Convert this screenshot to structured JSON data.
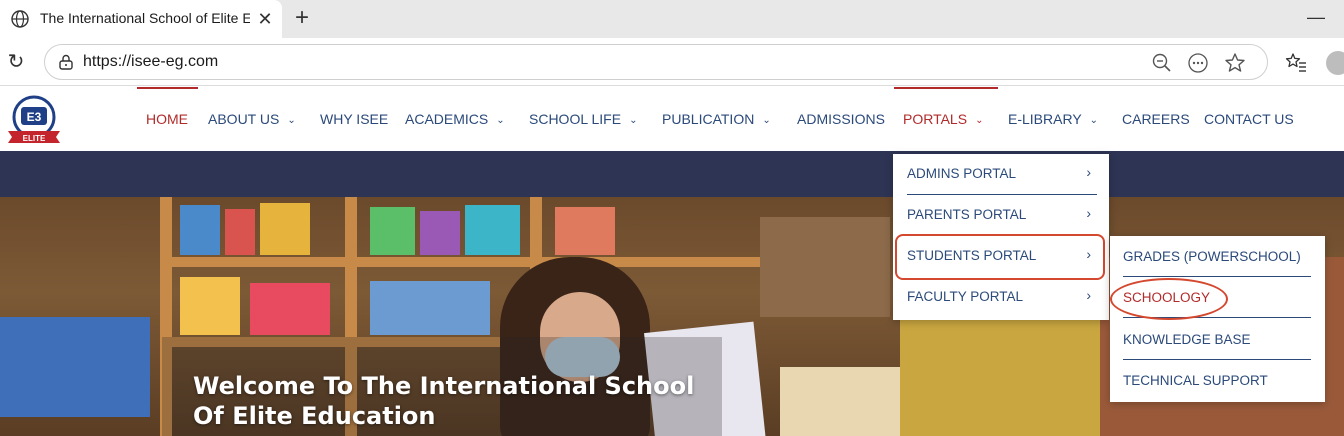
{
  "browser": {
    "tab_title": "The International School of Elite E",
    "url": "https://isee-eg.com",
    "icons": [
      "globe-icon",
      "close-icon",
      "plus-icon",
      "minimize-icon",
      "refresh-icon",
      "lock-icon",
      "zoom-out-icon",
      "more-icon",
      "star-icon",
      "favorites-icon",
      "avatar"
    ]
  },
  "site": {
    "logo_text": "ELITE",
    "nav": [
      {
        "label": "HOME",
        "has_menu": false
      },
      {
        "label": "ABOUT US",
        "has_menu": true
      },
      {
        "label": "WHY ISEE",
        "has_menu": false
      },
      {
        "label": "ACADEMICS",
        "has_menu": true
      },
      {
        "label": "SCHOOL LIFE",
        "has_menu": true
      },
      {
        "label": "PUBLICATION",
        "has_menu": true
      },
      {
        "label": "ADMISSIONS",
        "has_menu": false
      },
      {
        "label": "PORTALS",
        "has_menu": true
      },
      {
        "label": "E-LIBRARY",
        "has_menu": true
      },
      {
        "label": "CAREERS",
        "has_menu": false
      },
      {
        "label": "CONTACT US",
        "has_menu": false
      }
    ],
    "portals_menu": [
      {
        "label": "ADMINS PORTAL"
      },
      {
        "label": "PARENTS PORTAL"
      },
      {
        "label": "STUDENTS PORTAL"
      },
      {
        "label": "FACULTY PORTAL"
      }
    ],
    "students_menu": [
      {
        "label": "GRADES (POWERSCHOOL)"
      },
      {
        "label": "SCHOOLOGY"
      },
      {
        "label": "KNOWLEDGE BASE"
      },
      {
        "label": "TECHNICAL SUPPORT"
      }
    ],
    "hero_title": "Welcome To The International School Of Elite Education"
  },
  "colors": {
    "nav_text": "#2b4a7a",
    "accent_red": "#b22b2b",
    "navy_band": "#2e3454",
    "annotation": "#d4482f"
  }
}
